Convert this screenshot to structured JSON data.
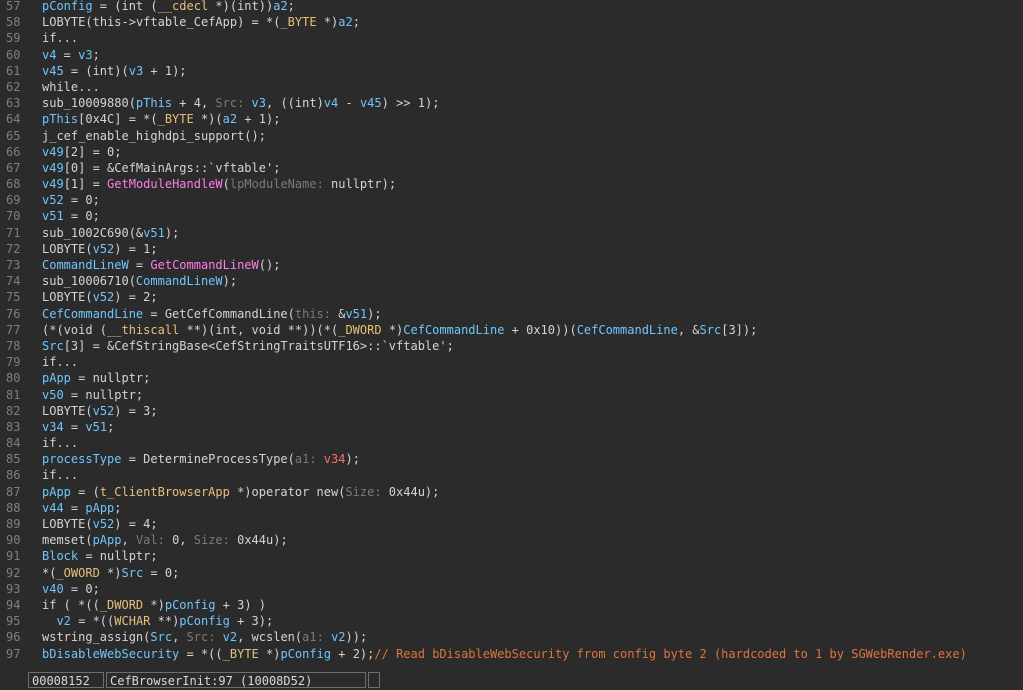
{
  "code_lines": [
    {
      "n": "57",
      "segs": [
        [
          "pConfig",
          "var"
        ],
        [
          " = (int (",
          "kw"
        ],
        [
          "__cdecl",
          "type"
        ],
        [
          " *)(int))",
          "kw"
        ],
        [
          "a2",
          "var"
        ],
        [
          ";",
          "kw"
        ]
      ]
    },
    {
      "n": "58",
      "segs": [
        [
          "LOBYTE",
          "kw"
        ],
        [
          "(",
          "kw"
        ],
        [
          "this",
          "kw"
        ],
        [
          "->vftable_CefApp) = *(",
          "kw"
        ],
        [
          "_BYTE",
          "type"
        ],
        [
          " *)",
          "kw"
        ],
        [
          "a2",
          "var"
        ],
        [
          ";",
          "kw"
        ]
      ]
    },
    {
      "n": "59",
      "segs": [
        [
          "if...",
          "kw"
        ]
      ]
    },
    {
      "n": "60",
      "segs": [
        [
          "v4",
          "var"
        ],
        [
          " = ",
          "kw"
        ],
        [
          "v3",
          "var"
        ],
        [
          ";",
          "kw"
        ]
      ]
    },
    {
      "n": "61",
      "segs": [
        [
          "v45",
          "var"
        ],
        [
          " = (int)(",
          "kw"
        ],
        [
          "v3",
          "var"
        ],
        [
          " + 1);",
          "kw"
        ]
      ]
    },
    {
      "n": "62",
      "segs": [
        [
          "while...",
          "kw"
        ]
      ]
    },
    {
      "n": "63",
      "segs": [
        [
          "sub_10009880(",
          "kw"
        ],
        [
          "pThis",
          "var"
        ],
        [
          " + 4, ",
          "kw"
        ],
        [
          "Src:",
          "hint"
        ],
        [
          " ",
          "kw"
        ],
        [
          "v3",
          "var"
        ],
        [
          ", ((int)",
          "kw"
        ],
        [
          "v4",
          "var"
        ],
        [
          " - ",
          "kw"
        ],
        [
          "v45",
          "var"
        ],
        [
          ") >> 1);",
          "kw"
        ]
      ]
    },
    {
      "n": "64",
      "segs": [
        [
          "pThis",
          "var"
        ],
        [
          "[0x4C] = *(",
          "kw"
        ],
        [
          "_BYTE",
          "type"
        ],
        [
          " *)(",
          "kw"
        ],
        [
          "a2",
          "var"
        ],
        [
          " + 1);",
          "kw"
        ]
      ]
    },
    {
      "n": "65",
      "segs": [
        [
          "j_cef_enable_highdpi_support();",
          "kw"
        ]
      ]
    },
    {
      "n": "66",
      "segs": [
        [
          "v49",
          "var"
        ],
        [
          "[2] = 0;",
          "kw"
        ]
      ]
    },
    {
      "n": "67",
      "segs": [
        [
          "v49",
          "var"
        ],
        [
          "[0] = &CefMainArgs::`vftable';",
          "kw"
        ]
      ]
    },
    {
      "n": "68",
      "segs": [
        [
          "v49",
          "var"
        ],
        [
          "[1] = ",
          "kw"
        ],
        [
          "GetModuleHandleW",
          "fn"
        ],
        [
          "(",
          "kw"
        ],
        [
          "lpModuleName:",
          "hint"
        ],
        [
          " nullptr);",
          "kw"
        ]
      ]
    },
    {
      "n": "69",
      "segs": [
        [
          "v52",
          "var"
        ],
        [
          " = 0;",
          "kw"
        ]
      ]
    },
    {
      "n": "70",
      "segs": [
        [
          "v51",
          "var"
        ],
        [
          " = 0;",
          "kw"
        ]
      ]
    },
    {
      "n": "71",
      "segs": [
        [
          "sub_1002C690(&",
          "kw"
        ],
        [
          "v51",
          "var"
        ],
        [
          ");",
          "kw"
        ]
      ]
    },
    {
      "n": "72",
      "segs": [
        [
          "LOBYTE",
          "kw"
        ],
        [
          "(",
          "kw"
        ],
        [
          "v52",
          "var"
        ],
        [
          ") = 1;",
          "kw"
        ]
      ]
    },
    {
      "n": "73",
      "segs": [
        [
          "CommandLineW",
          "var"
        ],
        [
          " = ",
          "kw"
        ],
        [
          "GetCommandLineW",
          "fn"
        ],
        [
          "();",
          "kw"
        ]
      ]
    },
    {
      "n": "74",
      "segs": [
        [
          "sub_10006710(",
          "kw"
        ],
        [
          "CommandLineW",
          "var"
        ],
        [
          ");",
          "kw"
        ]
      ]
    },
    {
      "n": "75",
      "segs": [
        [
          "LOBYTE",
          "kw"
        ],
        [
          "(",
          "kw"
        ],
        [
          "v52",
          "var"
        ],
        [
          ") = 2;",
          "kw"
        ]
      ]
    },
    {
      "n": "76",
      "segs": [
        [
          "CefCommandLine",
          "var"
        ],
        [
          " = GetCefCommandLine(",
          "kw"
        ],
        [
          "this:",
          "hint"
        ],
        [
          " &",
          "kw"
        ],
        [
          "v51",
          "var"
        ],
        [
          ");",
          "kw"
        ]
      ]
    },
    {
      "n": "77",
      "segs": [
        [
          "(*(void (",
          "kw"
        ],
        [
          "__thiscall",
          "type"
        ],
        [
          " **)(int, void **))(*(",
          "kw"
        ],
        [
          "_DWORD",
          "type"
        ],
        [
          " *)",
          "kw"
        ],
        [
          "CefCommandLine",
          "var"
        ],
        [
          " + 0x10))(",
          "kw"
        ],
        [
          "CefCommandLine",
          "var"
        ],
        [
          ", &",
          "kw"
        ],
        [
          "Src",
          "var"
        ],
        [
          "[3]);",
          "kw"
        ]
      ]
    },
    {
      "n": "78",
      "segs": [
        [
          "Src",
          "var"
        ],
        [
          "[3] = &CefStringBase<CefStringTraitsUTF16>::`vftable';",
          "kw"
        ]
      ]
    },
    {
      "n": "79",
      "segs": [
        [
          "if...",
          "kw"
        ]
      ]
    },
    {
      "n": "80",
      "segs": [
        [
          "pApp",
          "var"
        ],
        [
          " = nullptr;",
          "kw"
        ]
      ]
    },
    {
      "n": "81",
      "segs": [
        [
          "v50",
          "var"
        ],
        [
          " = nullptr;",
          "kw"
        ]
      ]
    },
    {
      "n": "82",
      "segs": [
        [
          "LOBYTE",
          "kw"
        ],
        [
          "(",
          "kw"
        ],
        [
          "v52",
          "var"
        ],
        [
          ") = 3;",
          "kw"
        ]
      ]
    },
    {
      "n": "83",
      "segs": [
        [
          "v34",
          "var"
        ],
        [
          " = ",
          "kw"
        ],
        [
          "v51",
          "var"
        ],
        [
          ";",
          "kw"
        ]
      ]
    },
    {
      "n": "84",
      "segs": [
        [
          "if...",
          "kw"
        ]
      ]
    },
    {
      "n": "85",
      "segs": [
        [
          "processType",
          "var"
        ],
        [
          " = DetermineProcessType(",
          "kw"
        ],
        [
          "a1:",
          "hint"
        ],
        [
          " ",
          "kw"
        ],
        [
          "v34",
          "red"
        ],
        [
          ");",
          "kw"
        ]
      ]
    },
    {
      "n": "86",
      "segs": [
        [
          "if...",
          "kw"
        ]
      ]
    },
    {
      "n": "87",
      "segs": [
        [
          "pApp",
          "var"
        ],
        [
          " = (",
          "kw"
        ],
        [
          "t_ClientBrowserApp",
          "type"
        ],
        [
          " *)operator new(",
          "kw"
        ],
        [
          "Size:",
          "hint"
        ],
        [
          " 0x44u);",
          "kw"
        ]
      ]
    },
    {
      "n": "88",
      "segs": [
        [
          "v44",
          "var"
        ],
        [
          " = ",
          "kw"
        ],
        [
          "pApp",
          "var"
        ],
        [
          ";",
          "kw"
        ]
      ]
    },
    {
      "n": "89",
      "segs": [
        [
          "LOBYTE",
          "kw"
        ],
        [
          "(",
          "kw"
        ],
        [
          "v52",
          "var"
        ],
        [
          ") = 4;",
          "kw"
        ]
      ]
    },
    {
      "n": "90",
      "segs": [
        [
          "memset(",
          "kw"
        ],
        [
          "pApp",
          "var"
        ],
        [
          ", ",
          "kw"
        ],
        [
          "Val:",
          "hint"
        ],
        [
          " 0, ",
          "kw"
        ],
        [
          "Size:",
          "hint"
        ],
        [
          " 0x44u);",
          "kw"
        ]
      ]
    },
    {
      "n": "91",
      "segs": [
        [
          "Block",
          "var"
        ],
        [
          " = nullptr;",
          "kw"
        ]
      ]
    },
    {
      "n": "92",
      "segs": [
        [
          "*(",
          "kw"
        ],
        [
          "_OWORD",
          "type"
        ],
        [
          " *)",
          "kw"
        ],
        [
          "Src",
          "var"
        ],
        [
          " = 0;",
          "kw"
        ]
      ]
    },
    {
      "n": "93",
      "segs": [
        [
          "v40",
          "var"
        ],
        [
          " = 0;",
          "kw"
        ]
      ]
    },
    {
      "n": "94",
      "segs": [
        [
          "if ( *((",
          "kw"
        ],
        [
          "_DWORD",
          "type"
        ],
        [
          " *)",
          "kw"
        ],
        [
          "pConfig",
          "var"
        ],
        [
          " + 3) )",
          "kw"
        ]
      ]
    },
    {
      "n": "95",
      "segs": [
        [
          "  v2",
          "var"
        ],
        [
          " = *((",
          "kw"
        ],
        [
          "WCHAR",
          "type"
        ],
        [
          " **)",
          "kw"
        ],
        [
          "pConfig",
          "var"
        ],
        [
          " + 3);",
          "kw"
        ]
      ]
    },
    {
      "n": "96",
      "segs": [
        [
          "wstring_assign(",
          "kw"
        ],
        [
          "Src",
          "var"
        ],
        [
          ", ",
          "kw"
        ],
        [
          "Src:",
          "hint"
        ],
        [
          " ",
          "kw"
        ],
        [
          "v2",
          "var"
        ],
        [
          ", wcslen(",
          "kw"
        ],
        [
          "a1:",
          "hint"
        ],
        [
          " ",
          "kw"
        ],
        [
          "v2",
          "var"
        ],
        [
          "));",
          "kw"
        ]
      ]
    },
    {
      "n": "97",
      "segs": [
        [
          "bDisableWebSecurity",
          "var"
        ],
        [
          " = *((",
          "kw"
        ],
        [
          "_BYTE",
          "type"
        ],
        [
          " *)",
          "kw"
        ],
        [
          "pConfig",
          "var"
        ],
        [
          " + 2);",
          "kw"
        ],
        [
          "// Read bDisableWebSecurity from config byte 2 (hardcoded to 1 by SGWebRender.exe)",
          "cmt"
        ]
      ]
    }
  ],
  "statusbar": {
    "address": "00008152",
    "location": "CefBrowserInit:97 (10008D52)",
    "empty": ""
  }
}
